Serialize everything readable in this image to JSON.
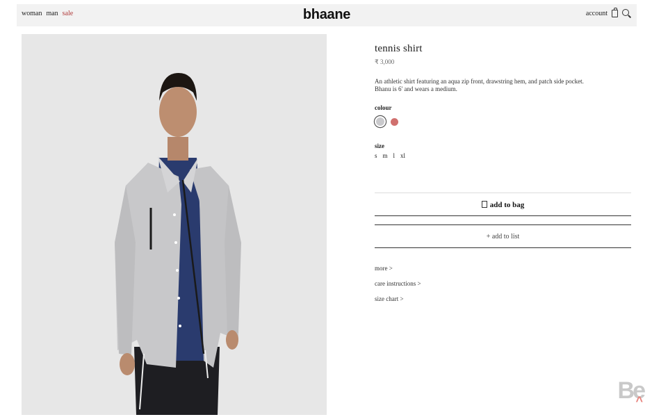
{
  "header": {
    "nav": [
      "woman",
      "man",
      "sale"
    ],
    "logo": "bhaane",
    "account": "account"
  },
  "product": {
    "title": "tennis shirt",
    "price": "₹ 3,000",
    "description": "An athletic shirt featuring an aqua zip front, drawstring hem, and patch side pocket. Bhanu is 6' and wears a medium.",
    "colour_label": "colour",
    "colours": [
      "#c9c9cc",
      "#d0706e"
    ],
    "size_label": "size",
    "sizes": [
      "s",
      "m",
      "l",
      "xl"
    ],
    "add_to_bag": "add to bag",
    "add_to_list": "+ add to list",
    "links": [
      "more >",
      "care instructions >",
      "size chart >"
    ]
  },
  "watermark": "Be"
}
